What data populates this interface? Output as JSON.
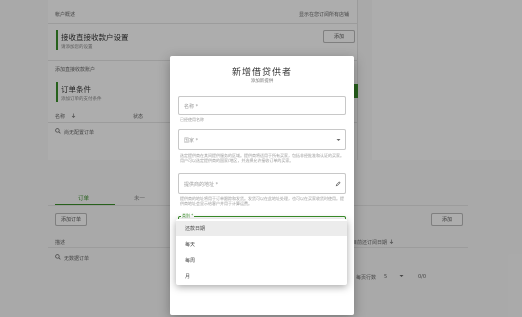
{
  "background": {
    "section1_label": "帐户概述",
    "section1_right_link": "显示在您订阅所有店铺",
    "card1_title": "接收直接收款户设置",
    "card1_subtitle": "请添加您的设置",
    "card1_button": "添加",
    "section2_label": "添加直接收款账户",
    "card2_title": "订单条件",
    "card2_subtitle": "添加订单的支付条件",
    "table_col1": "名称",
    "table_col2": "状态",
    "empty_text": "尚无配置订单",
    "tab1": "订单",
    "tab2": "未一",
    "add_button": "添加订单",
    "right_button": "添加",
    "table2_col": "描述",
    "table2_right_col": "目前还订阅日期",
    "empty_text2": "无数据订单",
    "pagination_label": "每页行数",
    "pagination_value": "5",
    "pagination_range": "0/0"
  },
  "dialog": {
    "title": "新增借贷供者",
    "subtitle": "添加新提供",
    "field1_label": "名称 *",
    "field1_helper": "已经使用名称",
    "field2_label": "国家 *",
    "field2_helper": "选定提供商在其间提供服务的区域。提供商将适用于所有买家，包括非经批准和认证的买家。用户可以选定提供商的国家/地区，并选择允许接收订单的买家。",
    "field3_label": "提供商的地址 *",
    "field3_helper": "提供商的地址将用于订单跟踪和发货。发货可以在此地址处理，也可以在买家收货时使用。提供商地址会显示给客户并用于计算运费。",
    "field4_label": "类别 *"
  },
  "menu": {
    "items": [
      "还款日期",
      "每天",
      "每周",
      "月"
    ]
  },
  "colors": {
    "accent": "#3a8f2a",
    "scrim": "rgba(0,0,0,0.32)"
  },
  "icons": {
    "search": "magnifier-icon",
    "caret": "caret-down-icon",
    "edit": "pen-icon"
  }
}
